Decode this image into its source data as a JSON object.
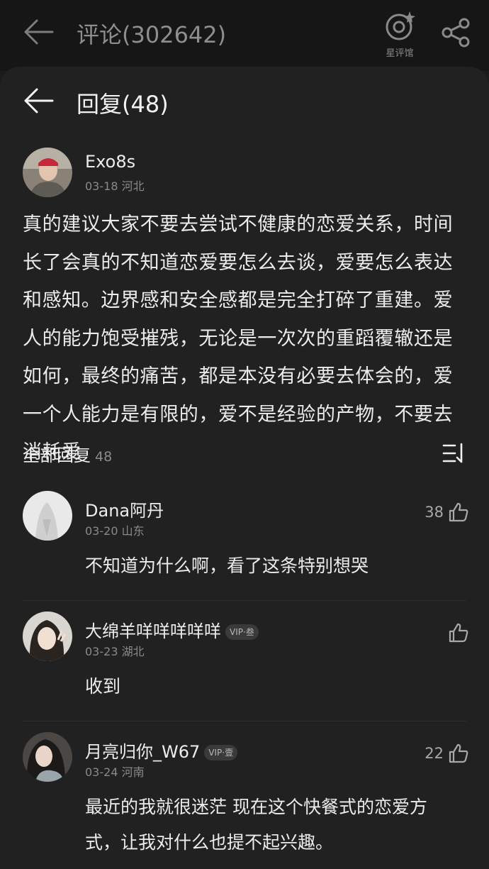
{
  "topbar": {
    "title": "评论(302642)",
    "star_label": "星评馆"
  },
  "sheet": {
    "title": "回复(48)"
  },
  "root_comment": {
    "username": "Exo8s",
    "date": "03-18",
    "location": "河北",
    "text": "真的建议大家不要去尝试不健康的恋爱关系，时间长了会真的不知道恋爱要怎么去谈，爱要怎么表达和感知。边界感和安全感都是完全打碎了重建。爱人的能力饱受摧残，无论是一次次的重蹈覆辙还是如何，最终的痛苦，都是本没有必要去体会的，爱一个人能力是有限的，爱不是经验的产物，不要去消耗爱"
  },
  "replies_header": {
    "label": "全部回复",
    "count": "48"
  },
  "replies": [
    {
      "username": "Dana阿丹",
      "date": "03-20",
      "location": "山东",
      "text": "不知道为什么啊，看了这条特别想哭",
      "likes": "38"
    },
    {
      "username": "大绵羊咩咩咩咩咩",
      "badge": "VIP·叁",
      "date": "03-23",
      "location": "湖北",
      "text": "收到",
      "likes": ""
    },
    {
      "username": "月亮归你_W67",
      "badge": "VIP·壹",
      "date": "03-24",
      "location": "河南",
      "text": "最近的我就很迷茫 现在这个快餐式的恋爱方式，让我对什么也提不起兴趣。",
      "likes": "22"
    }
  ],
  "colors": {
    "background": "#1b1b1b",
    "sheet": "#212121",
    "text": "#ececec",
    "muted": "#8a8a8a"
  }
}
